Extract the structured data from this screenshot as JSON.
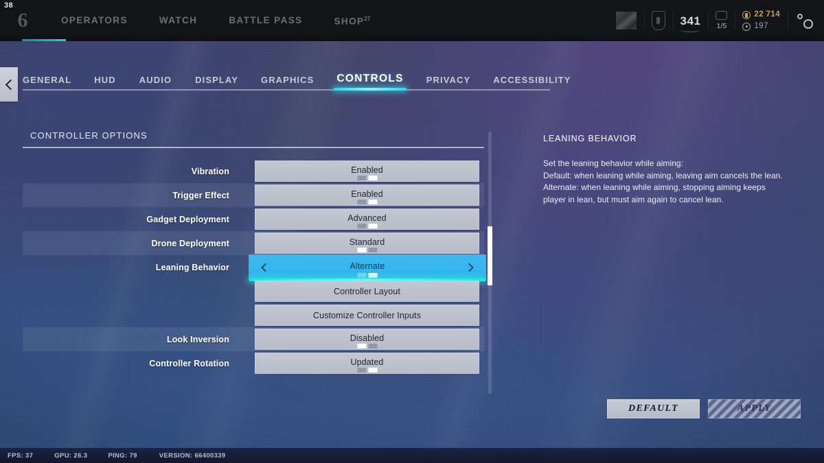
{
  "overlay": {
    "fps_counter": "38"
  },
  "topnav": {
    "logo": "6",
    "links": [
      {
        "label": "OPERATORS",
        "sup": ""
      },
      {
        "label": "WATCH",
        "sup": ""
      },
      {
        "label": "BATTLE PASS",
        "sup": ""
      },
      {
        "label": "SHOP",
        "sup": "27"
      }
    ],
    "player": {
      "level": "341",
      "squad_count": "1/5",
      "r6_credits": "22 714",
      "alpha_packs": "197"
    },
    "settings_icon": "gear-icon"
  },
  "back_button": {
    "icon": "chevron-left-icon",
    "label": "Back"
  },
  "tabs": [
    {
      "label": "GENERAL",
      "active": false
    },
    {
      "label": "HUD",
      "active": false
    },
    {
      "label": "AUDIO",
      "active": false
    },
    {
      "label": "DISPLAY",
      "active": false
    },
    {
      "label": "GRAPHICS",
      "active": false
    },
    {
      "label": "CONTROLS",
      "active": true
    },
    {
      "label": "PRIVACY",
      "active": false
    },
    {
      "label": "ACCESSIBILITY",
      "active": false
    }
  ],
  "section": {
    "title": "CONTROLLER OPTIONS",
    "rows": [
      {
        "label": "Vibration",
        "value": "Enabled",
        "type": "option",
        "dots": 2,
        "active_dot": 1,
        "selected": false,
        "stripe": false
      },
      {
        "label": "Trigger Effect",
        "value": "Enabled",
        "type": "option",
        "dots": 2,
        "active_dot": 1,
        "selected": false,
        "stripe": true
      },
      {
        "label": "Gadget Deployment",
        "value": "Advanced",
        "type": "option",
        "dots": 2,
        "active_dot": 1,
        "selected": false,
        "stripe": false
      },
      {
        "label": "Drone Deployment",
        "value": "Standard",
        "type": "option",
        "dots": 2,
        "active_dot": 0,
        "selected": false,
        "stripe": true
      },
      {
        "label": "Leaning Behavior",
        "value": "Alternate",
        "type": "option",
        "dots": 2,
        "active_dot": 1,
        "selected": true,
        "stripe": false
      },
      {
        "label": "",
        "value": "Controller Layout",
        "type": "action",
        "dots": 0,
        "active_dot": -1,
        "selected": false,
        "stripe": false
      },
      {
        "label": "",
        "value": "Customize Controller Inputs",
        "type": "action",
        "dots": 0,
        "active_dot": -1,
        "selected": false,
        "stripe": false
      },
      {
        "label": "Look Inversion",
        "value": "Disabled",
        "type": "option",
        "dots": 2,
        "active_dot": 0,
        "selected": false,
        "stripe": true
      },
      {
        "label": "Controller Rotation",
        "value": "Updated",
        "type": "option",
        "dots": 2,
        "active_dot": 1,
        "selected": false,
        "stripe": false
      }
    ]
  },
  "description": {
    "title": "LEANING BEHAVIOR",
    "lines": [
      "Set the leaning behavior while aiming:",
      "Default: when leaning while aiming, leaving aim cancels the lean.",
      "Alternate: when leaning while aiming, stopping aiming keeps player in lean, but must aim again to cancel lean."
    ]
  },
  "actions": {
    "default_label": "DEFAULT",
    "apply_label": "APPLY"
  },
  "status_bar": {
    "fps": "FPS: 37",
    "gpu": "GPU: 26.3",
    "ping": "PING: 79",
    "version": "VERSION: 66400339"
  },
  "colors": {
    "accent_cyan": "#2fb3ee",
    "glow_cyan": "#1fe7e0",
    "gold": "#c9a550",
    "panel_grey": "#bfc4cf"
  }
}
